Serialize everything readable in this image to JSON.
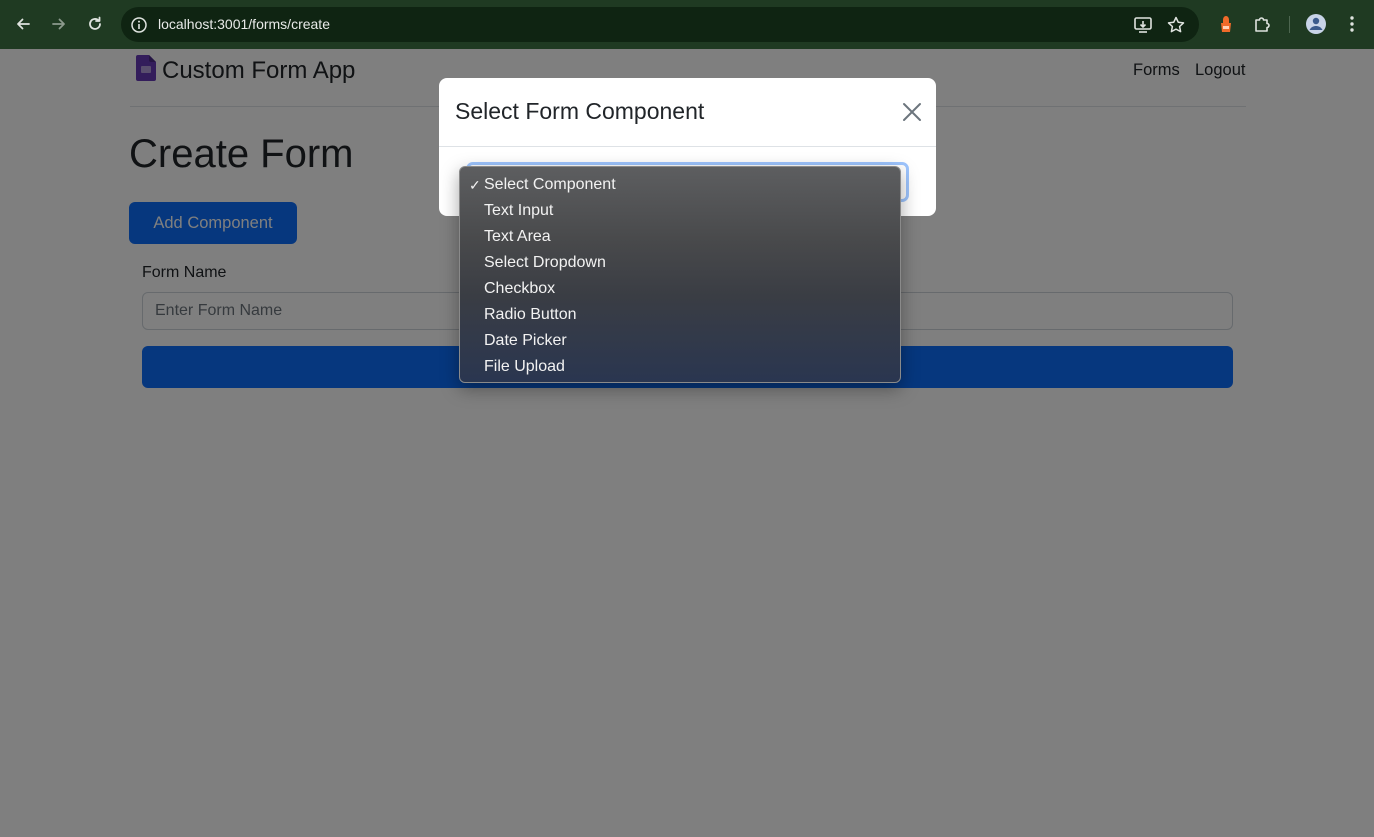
{
  "browser": {
    "url": "localhost:3001/forms/create",
    "icons": [
      "back-arrow-icon",
      "forward-arrow-icon",
      "reload-icon",
      "site-info-icon",
      "install-app-icon",
      "bookmark-star-icon",
      "extension-puzzle-icon",
      "extensions-icon",
      "profile-avatar-icon",
      "menu-kebab-icon"
    ]
  },
  "navbar": {
    "brand": "Custom Form App",
    "links": [
      "Forms",
      "Logout"
    ],
    "brand_icon": "form-document-icon",
    "brand_icon_color": "#673ab7"
  },
  "main": {
    "title": "Create Form",
    "add_button": "Add Component",
    "form_name_label": "Form Name",
    "form_name_placeholder": "Enter Form Name"
  },
  "modal": {
    "title": "Select Form Component",
    "close_icon": "close-x-icon",
    "select_selected": "Select Component",
    "options": [
      "Select Component",
      "Text Input",
      "Text Area",
      "Select Dropdown",
      "Checkbox",
      "Radio Button",
      "Date Picker",
      "File Upload"
    ]
  },
  "colors": {
    "primary": "#0d6efd",
    "chrome_bar": "#1f3a22",
    "backdrop": "rgba(0,0,0,0.5)"
  }
}
